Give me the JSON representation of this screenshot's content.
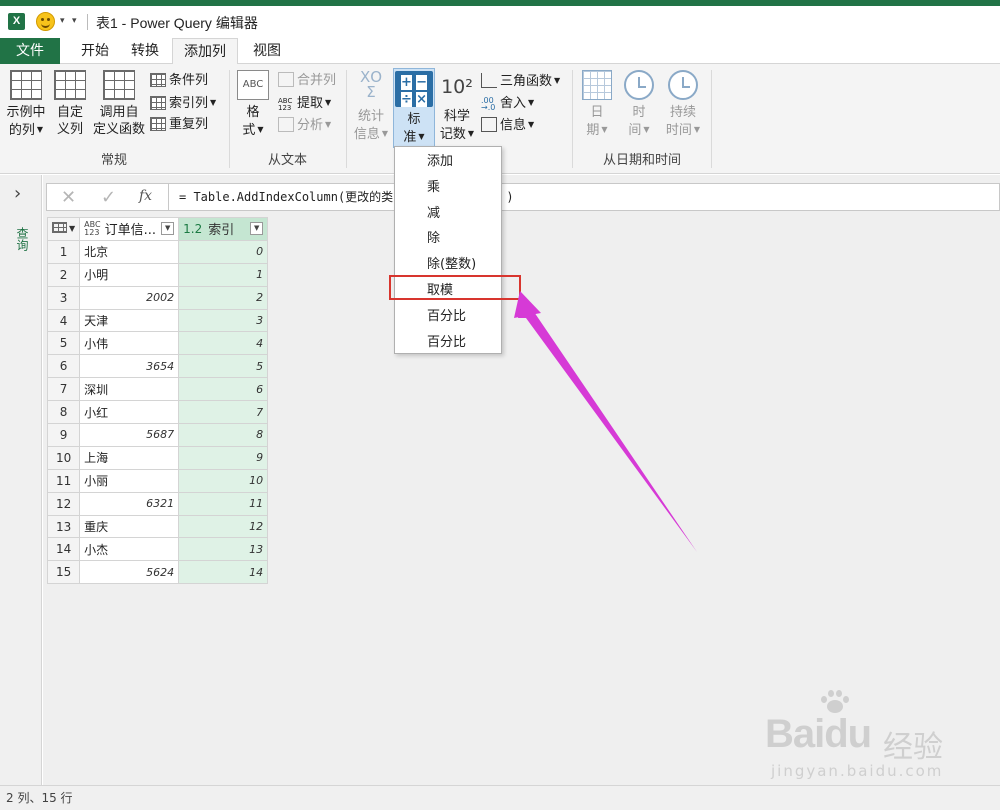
{
  "titlebar": {
    "title": "表1 - Power Query 编辑器",
    "app_icon": "X",
    "qat_arrow": "▾"
  },
  "tabs": [
    {
      "label": "文件"
    },
    {
      "label": "开始"
    },
    {
      "label": "转换"
    },
    {
      "label": "添加列"
    },
    {
      "label": "视图"
    }
  ],
  "ribbon": {
    "groups": {
      "general": {
        "label": "常规",
        "example_col": [
          "示例中",
          "的列"
        ],
        "custom_col": [
          "自定",
          "义列"
        ],
        "invoke_fn": [
          "调用自",
          "定义函数"
        ],
        "conditional": "条件列",
        "index": "索引列",
        "duplicate": "重复列"
      },
      "from_text": {
        "label": "从文本",
        "format": [
          "格",
          "式"
        ],
        "merge": "合并列",
        "extract": "提取",
        "parse": "分析",
        "icon_abc": "ABC",
        "icon_abc123": "ABC\n123"
      },
      "from_number": {
        "label": "",
        "stats": [
          "统计",
          "信息"
        ],
        "standard": [
          "标",
          "准"
        ],
        "scientific": [
          "科学",
          "记数"
        ],
        "trig": "三角函数",
        "round": "舍入",
        "info": "信息",
        "icon_stats": "XΟ\nΣ",
        "icon_sci": "10²",
        "std_glyphs": [
          "+",
          "−",
          "÷",
          "×"
        ]
      },
      "datetime": {
        "label": "从日期和时间",
        "date": [
          "日",
          "期"
        ],
        "time": [
          "时",
          "间"
        ],
        "duration": [
          "持续",
          "时间"
        ]
      }
    }
  },
  "formula_bar": {
    "cancel": "✕",
    "confirm": "✓",
    "fx": "fx",
    "formula": "= Table.AddIndexColumn(更改的类 ",
    "formula_tail": ")"
  },
  "left_pane": {
    "expand": "›",
    "label": "查询"
  },
  "table": {
    "columns": [
      {
        "type": "ABC\n123",
        "name": "订单信..."
      },
      {
        "type": "1.2",
        "name": "索引"
      }
    ],
    "rows": [
      {
        "n": "1",
        "text": "北京",
        "num": "",
        "idx": "0"
      },
      {
        "n": "2",
        "text": "小明",
        "num": "",
        "idx": "1"
      },
      {
        "n": "3",
        "text": "",
        "num": "2002",
        "idx": "2"
      },
      {
        "n": "4",
        "text": "天津",
        "num": "",
        "idx": "3"
      },
      {
        "n": "5",
        "text": "小伟",
        "num": "",
        "idx": "4"
      },
      {
        "n": "6",
        "text": "",
        "num": "3654",
        "idx": "5"
      },
      {
        "n": "7",
        "text": "深圳",
        "num": "",
        "idx": "6"
      },
      {
        "n": "8",
        "text": "小红",
        "num": "",
        "idx": "7"
      },
      {
        "n": "9",
        "text": "",
        "num": "5687",
        "idx": "8"
      },
      {
        "n": "10",
        "text": "上海",
        "num": "",
        "idx": "9"
      },
      {
        "n": "11",
        "text": "小丽",
        "num": "",
        "idx": "10"
      },
      {
        "n": "12",
        "text": "",
        "num": "6321",
        "idx": "11"
      },
      {
        "n": "13",
        "text": "重庆",
        "num": "",
        "idx": "12"
      },
      {
        "n": "14",
        "text": "小杰",
        "num": "",
        "idx": "13"
      },
      {
        "n": "15",
        "text": "",
        "num": "5624",
        "idx": "14"
      }
    ]
  },
  "dropdown": {
    "items": [
      "添加",
      "乘",
      "减",
      "除",
      "除(整数)",
      "取模",
      "百分比",
      "百分比"
    ],
    "highlighted_index": 5
  },
  "status": {
    "text": "2 列、15 行"
  },
  "watermark": {
    "logo": "Baidu",
    "jy": "经验",
    "url": "jingyan.baidu.com"
  },
  "colors": {
    "excel_green": "#217346",
    "selected_column": "#dff2e6",
    "highlight_box": "#d8352e",
    "arrow": "#d63ad6"
  }
}
